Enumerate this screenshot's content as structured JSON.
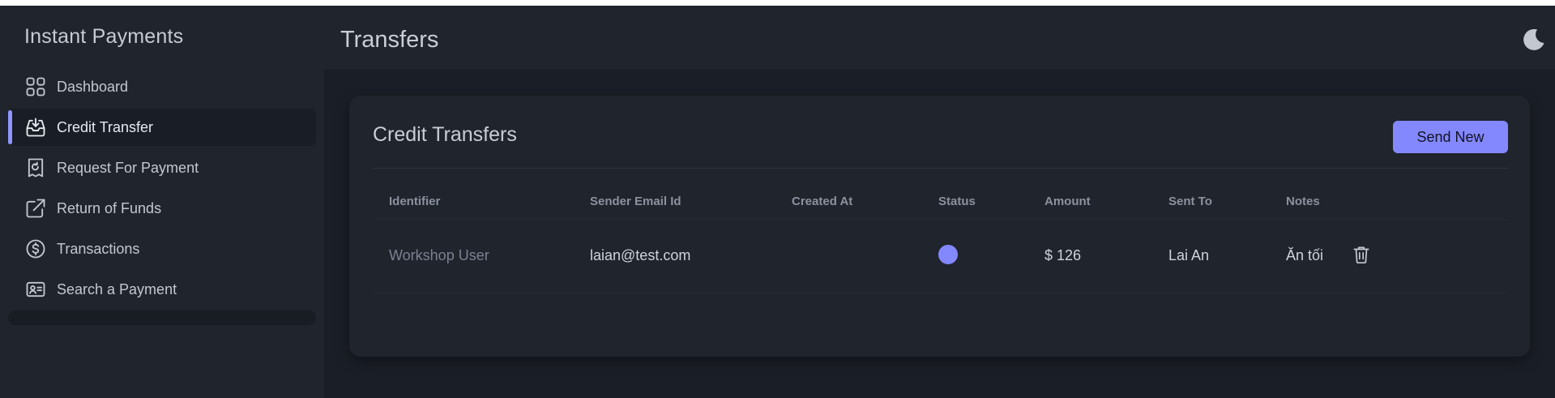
{
  "app": {
    "title": "Instant Payments"
  },
  "sidebar": {
    "items": [
      {
        "label": "Dashboard",
        "icon": "grid-icon",
        "active": false
      },
      {
        "label": "Credit Transfer",
        "icon": "inbox-download-icon",
        "active": true
      },
      {
        "label": "Request For Payment",
        "icon": "receipt-refund-icon",
        "active": false
      },
      {
        "label": "Return of Funds",
        "icon": "external-link-icon",
        "active": false
      },
      {
        "label": "Transactions",
        "icon": "dollar-circle-icon",
        "active": false
      },
      {
        "label": "Search a Payment",
        "icon": "id-card-icon",
        "active": false
      }
    ]
  },
  "header": {
    "title": "Transfers",
    "theme_icon": "moon-icon"
  },
  "card": {
    "title": "Credit Transfers",
    "send_button": "Send New",
    "columns": [
      "Identifier",
      "Sender Email Id",
      "Created At",
      "Status",
      "Amount",
      "Sent To",
      "Notes"
    ],
    "rows": [
      {
        "identifier": "Workshop User",
        "sender_email": "laian@test.com",
        "created_at": "",
        "status_color": "#8488ff",
        "amount": "$ 126",
        "sent_to": "Lai An",
        "notes": "Ăn tối"
      }
    ]
  },
  "colors": {
    "accent": "#8488ff",
    "sidebar_bg": "#1f242d",
    "main_bg": "#1a1e26"
  }
}
